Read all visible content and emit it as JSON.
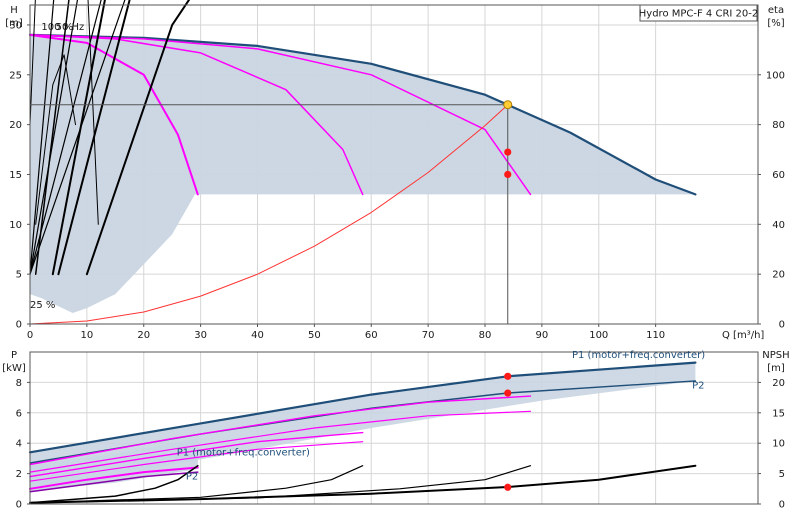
{
  "chart_data": [
    {
      "type": "line",
      "title": "Hydro MPC-F 4 CRI 20-2",
      "xlabel": "Q [m³/h]",
      "ylabel_left": "H",
      "ylabel_left_unit": "[m]",
      "ylabel_right": "eta",
      "ylabel_right_unit": "[%]",
      "xlim": [
        0,
        128
      ],
      "ylim": [
        0,
        32
      ],
      "y2lim": [
        0,
        128
      ],
      "grid": true,
      "xticks": [
        "0",
        "10",
        "20",
        "30",
        "40",
        "50",
        "60",
        "70",
        "80",
        "90",
        "100",
        "110"
      ],
      "yticks": [
        "0",
        "5",
        "10",
        "15",
        "20",
        "25",
        "30"
      ],
      "y2ticks": [
        "0",
        "20",
        "40",
        "60",
        "80",
        "100"
      ],
      "annotations": [
        {
          "text": "100 %",
          "x": 2,
          "y": 29.5
        },
        {
          "text": "50 Hz",
          "x": 4.5,
          "y": 29.5
        },
        {
          "text": "25 %",
          "x": 0,
          "y": 1.6
        }
      ],
      "duty_point": {
        "q": 84,
        "h": 22
      },
      "operating_points": [
        {
          "q": 84,
          "y2": 69
        },
        {
          "q": 84,
          "y2": 60
        }
      ],
      "envelope": {
        "upper": [
          [
            0,
            29
          ],
          [
            20,
            28.7
          ],
          [
            40,
            27.9
          ],
          [
            60,
            26.1
          ],
          [
            80,
            23
          ],
          [
            95,
            19.2
          ],
          [
            110,
            14.5
          ],
          [
            117,
            13
          ]
        ],
        "lower": [
          [
            117,
            13
          ],
          [
            80,
            13
          ],
          [
            29,
            13
          ],
          [
            25,
            9
          ],
          [
            20,
            6
          ],
          [
            15,
            3
          ],
          [
            10,
            1.6
          ],
          [
            7.5,
            1.1
          ],
          [
            2,
            2.6
          ],
          [
            0,
            3
          ]
        ]
      },
      "series": [
        {
          "role": "H speed 100%",
          "color": "#1f4e79",
          "width": 2.2,
          "points": [
            [
              0,
              29
            ],
            [
              20,
              28.7
            ],
            [
              40,
              27.9
            ],
            [
              60,
              26.1
            ],
            [
              80,
              23
            ],
            [
              95,
              19.2
            ],
            [
              110,
              14.5
            ],
            [
              117,
              13
            ]
          ]
        },
        {
          "role": "H speed 3 pumps",
          "color": "#ff00ff",
          "width": 1.5,
          "points": [
            [
              0,
              29
            ],
            [
              20,
              28.6
            ],
            [
              40,
              27.6
            ],
            [
              60,
              25
            ],
            [
              80,
              19.5
            ],
            [
              88,
              13
            ]
          ]
        },
        {
          "role": "H speed 2 pumps",
          "color": "#ff00ff",
          "width": 1.5,
          "points": [
            [
              0,
              29
            ],
            [
              15,
              28.6
            ],
            [
              30,
              27.2
            ],
            [
              45,
              23.5
            ],
            [
              55,
              17.5
            ],
            [
              58.5,
              13
            ]
          ]
        },
        {
          "role": "H speed 1 pump",
          "color": "#ff00ff",
          "width": 2,
          "points": [
            [
              0,
              29
            ],
            [
              10,
              28.2
            ],
            [
              20,
              25
            ],
            [
              26,
              19
            ],
            [
              29.5,
              13
            ]
          ]
        },
        {
          "role": "eta 4 pumps",
          "color": "#000000",
          "width": 1.2,
          "points": [
            [
              0,
              5
            ],
            [
              20,
              38
            ],
            [
              40,
              56
            ],
            [
              60,
              66
            ],
            [
              80,
              69
            ],
            [
              100,
              64
            ],
            [
              117,
              52
            ]
          ]
        },
        {
          "role": "eta 3 pumps",
          "color": "#000000",
          "width": 1.2,
          "points": [
            [
              0,
              5
            ],
            [
              15,
              38
            ],
            [
              30,
              57
            ],
            [
              45,
              66
            ],
            [
              60,
              69
            ],
            [
              75,
              64
            ],
            [
              88,
              52
            ]
          ]
        },
        {
          "role": "eta 2 pumps",
          "color": "#000000",
          "width": 1.2,
          "points": [
            [
              0,
              5
            ],
            [
              10,
              38
            ],
            [
              20,
              57
            ],
            [
              30,
              66
            ],
            [
              40,
              69
            ],
            [
              50,
              64
            ],
            [
              58.5,
              52
            ]
          ]
        },
        {
          "role": "eta 1 pump",
          "color": "#000000",
          "width": 1.2,
          "points": [
            [
              0,
              5
            ],
            [
              5,
              38
            ],
            [
              10,
              57
            ],
            [
              15,
              66
            ],
            [
              20,
              69
            ],
            [
              25,
              64
            ],
            [
              29.5,
              52
            ]
          ]
        },
        {
          "role": "eta part-load 4 pumps",
          "color": "#000000",
          "width": 2,
          "points": [
            [
              10,
              5
            ],
            [
              25,
              30
            ],
            [
              45,
              47
            ],
            [
              65,
              57
            ],
            [
              84,
              60
            ],
            [
              100,
              56
            ],
            [
              117,
              44
            ]
          ]
        },
        {
          "role": "eta part-load 3 pumps",
          "color": "#000000",
          "width": 2,
          "points": [
            [
              5,
              5
            ],
            [
              20,
              38
            ],
            [
              40,
              54
            ],
            [
              58,
              59
            ],
            [
              74,
              56
            ],
            [
              88,
              44
            ]
          ]
        },
        {
          "role": "eta part-load 2 pumps",
          "color": "#000000",
          "width": 2,
          "points": [
            [
              4,
              5
            ],
            [
              15,
              38
            ],
            [
              28,
              53
            ],
            [
              40,
              58
            ],
            [
              50,
              55
            ],
            [
              58.5,
              44
            ]
          ]
        },
        {
          "role": "eta part-load 1 pump",
          "color": "#000000",
          "width": 1.5,
          "points": [
            [
              1,
              5
            ],
            [
              8,
              38
            ],
            [
              15,
              53
            ],
            [
              20,
              58
            ],
            [
              25,
              55
            ],
            [
              29.5,
              44
            ]
          ]
        },
        {
          "role": "eta small lobe",
          "color": "#000000",
          "width": 1,
          "points": [
            [
              0,
              20
            ],
            [
              3,
              60
            ],
            [
              5,
              70
            ],
            [
              7,
              62
            ],
            [
              10,
              35
            ],
            [
              12,
              10
            ]
          ]
        },
        {
          "role": "eta small lobe 2",
          "color": "#000000",
          "width": 1,
          "points": [
            [
              1,
              10
            ],
            [
              4,
              24
            ],
            [
              6,
              27
            ],
            [
              8,
              20
            ]
          ]
        },
        {
          "role": "system curve",
          "color": "#ff3333",
          "width": 1,
          "points": [
            [
              0,
              0
            ],
            [
              10,
              0.3
            ],
            [
              20,
              1.2
            ],
            [
              30,
              2.8
            ],
            [
              40,
              5
            ],
            [
              50,
              7.8
            ],
            [
              60,
              11.2
            ],
            [
              70,
              15.2
            ],
            [
              80,
              19.9
            ],
            [
              84,
              22
            ]
          ]
        }
      ]
    },
    {
      "type": "line",
      "xlabel": "",
      "ylabel_left": "P",
      "ylabel_left_unit": "[kW]",
      "ylabel_right": "NPSH",
      "ylabel_right_unit": "[m]",
      "xlim": [
        0,
        128
      ],
      "ylim": [
        0,
        10
      ],
      "y2lim": [
        0,
        25
      ],
      "grid": true,
      "yticks": [
        "0",
        "2",
        "4",
        "6",
        "8"
      ],
      "y2ticks": [
        "0",
        "5",
        "10",
        "15",
        "20"
      ],
      "annotations": [
        {
          "text": "P1 (motor+freq.converter)",
          "x": 107,
          "y": 9.6,
          "color": "#1f4e79"
        },
        {
          "text": "P2",
          "x": 117.5,
          "y": 7.6,
          "color": "#1f4e79"
        },
        {
          "text": "P1 (motor+freq.converter)",
          "x": 37.5,
          "y": 3.2,
          "color": "#1f4e79"
        },
        {
          "text": "P2",
          "x": 28.5,
          "y": 1.6,
          "color": "#1f4e79"
        }
      ],
      "operating_points": [
        {
          "q": 84,
          "y": 8.4
        },
        {
          "q": 84,
          "y": 7.3
        },
        {
          "q": 84,
          "y": 1.1
        }
      ],
      "bands": [
        {
          "upper": [
            [
              0,
              3.4
            ],
            [
              30,
              5.3
            ],
            [
              60,
              7.2
            ],
            [
              84,
              8.4
            ],
            [
              117,
              9.3
            ]
          ],
          "lower": [
            [
              117,
              8.1
            ],
            [
              90,
              6.8
            ],
            [
              60,
              5
            ],
            [
              40,
              3.6
            ],
            [
              25,
              2.6
            ],
            [
              10,
              1.4
            ],
            [
              0,
              0.8
            ]
          ]
        },
        {
          "upper": [
            [
              0,
              2.5
            ],
            [
              15,
              3.3
            ],
            [
              29.5,
              4.3
            ]
          ],
          "lower": [
            [
              29.5,
              2.3
            ],
            [
              15,
              1.4
            ],
            [
              0,
              0.9
            ]
          ]
        }
      ],
      "series": [
        {
          "role": "P1 4 pumps",
          "color": "#1f4e79",
          "width": 2.2,
          "points": [
            [
              0,
              3.4
            ],
            [
              30,
              5.3
            ],
            [
              60,
              7.2
            ],
            [
              84,
              8.4
            ],
            [
              117,
              9.3
            ]
          ]
        },
        {
          "role": "P2 4 pumps",
          "color": "#1f4e79",
          "width": 1.4,
          "points": [
            [
              0,
              2.7
            ],
            [
              30,
              4.6
            ],
            [
              60,
              6.3
            ],
            [
              84,
              7.3
            ],
            [
              117,
              8.1
            ]
          ]
        },
        {
          "role": "P1 3 pumps",
          "color": "#ff00ff",
          "width": 1.4,
          "points": [
            [
              0,
              2.6
            ],
            [
              25,
              4.3
            ],
            [
              50,
              5.8
            ],
            [
              70,
              6.7
            ],
            [
              88,
              7.1
            ]
          ]
        },
        {
          "role": "P2 3 pumps",
          "color": "#ff00ff",
          "width": 1.2,
          "points": [
            [
              0,
              2.1
            ],
            [
              25,
              3.6
            ],
            [
              50,
              5
            ],
            [
              70,
              5.8
            ],
            [
              88,
              6.1
            ]
          ]
        },
        {
          "role": "P1 2 pumps",
          "color": "#ff00ff",
          "width": 1.4,
          "points": [
            [
              0,
              1.8
            ],
            [
              20,
              3
            ],
            [
              40,
              4.1
            ],
            [
              58.5,
              4.7
            ]
          ]
        },
        {
          "role": "P2 2 pumps",
          "color": "#ff00ff",
          "width": 1.2,
          "points": [
            [
              0,
              1.5
            ],
            [
              20,
              2.6
            ],
            [
              40,
              3.6
            ],
            [
              58.5,
              4.1
            ]
          ]
        },
        {
          "role": "P1 1 pump",
          "color": "#ff00ff",
          "width": 2,
          "points": [
            [
              0,
              1
            ],
            [
              10,
              1.6
            ],
            [
              20,
              2.1
            ],
            [
              29.5,
              2.4
            ]
          ]
        },
        {
          "role": "P2 1 pump",
          "color": "#8800aa",
          "width": 1.5,
          "points": [
            [
              0,
              0.8
            ],
            [
              10,
              1.3
            ],
            [
              20,
              1.8
            ],
            [
              29.5,
              2.1
            ]
          ]
        },
        {
          "role": "NPSH 4 pumps",
          "color": "#000000",
          "width": 2,
          "y_axis": "right",
          "points": [
            [
              0,
              0.2
            ],
            [
              30,
              0.8
            ],
            [
              60,
              1.7
            ],
            [
              84,
              2.8
            ],
            [
              100,
              4
            ],
            [
              117,
              6.3
            ]
          ]
        },
        {
          "role": "NPSH 3 pumps",
          "color": "#000000",
          "width": 1.2,
          "y_axis": "right",
          "points": [
            [
              0,
              0.2
            ],
            [
              40,
              1
            ],
            [
              65,
              2.5
            ],
            [
              80,
              4
            ],
            [
              88,
              6.3
            ]
          ]
        },
        {
          "role": "NPSH 2 pumps",
          "color": "#000000",
          "width": 1.2,
          "y_axis": "right",
          "points": [
            [
              0,
              0.2
            ],
            [
              30,
              1.1
            ],
            [
              45,
              2.6
            ],
            [
              53,
              4
            ],
            [
              58.5,
              6.3
            ]
          ]
        },
        {
          "role": "NPSH 1 pump",
          "color": "#000000",
          "width": 1.5,
          "y_axis": "right",
          "points": [
            [
              0,
              0.2
            ],
            [
              15,
              1.3
            ],
            [
              22,
              2.6
            ],
            [
              26,
              4
            ],
            [
              29.5,
              6.3
            ]
          ]
        }
      ]
    }
  ]
}
